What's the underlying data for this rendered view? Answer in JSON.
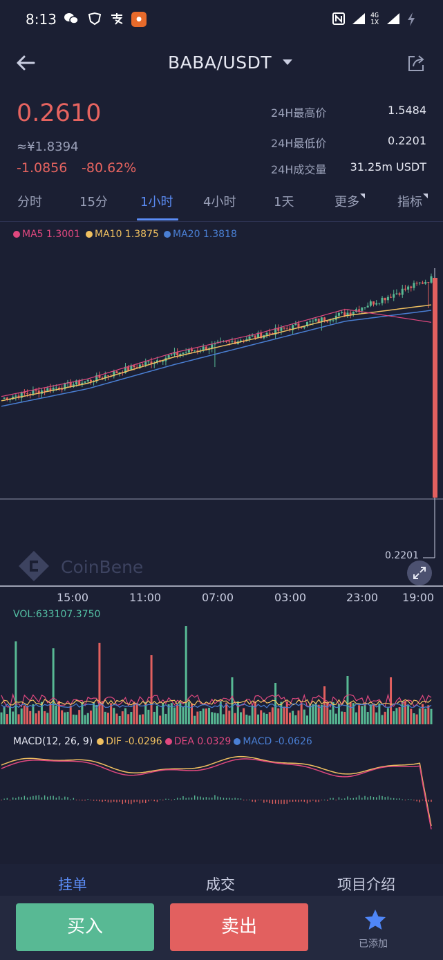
{
  "status_bar": {
    "time": "8:13",
    "network": "4G",
    "sim": "1X"
  },
  "header": {
    "pair": "BABA/USDT"
  },
  "price": {
    "last": "0.2610",
    "cny": "≈¥1.8394",
    "change_abs": "-1.0856",
    "change_pct": "-80.62%"
  },
  "stats": [
    {
      "label": "24H最高价",
      "value": "1.5484"
    },
    {
      "label": "24H最低价",
      "value": "0.2201"
    },
    {
      "label": "24H成交量",
      "value": "31.25m USDT"
    }
  ],
  "interval_tabs": [
    "分时",
    "15分",
    "1小时",
    "4小时",
    "1天",
    "更多",
    "指标"
  ],
  "active_tab": "1小时",
  "ma_legend": {
    "ma5": "MA5 1.3001",
    "ma10": "MA10 1.3875",
    "ma20": "MA20 1.3818"
  },
  "colors": {
    "up": "#58b994",
    "down": "#e2605f",
    "ma5": "#e0487f",
    "ma10": "#f0c060",
    "ma20": "#4a7fd4",
    "accent": "#5b8cf5"
  },
  "watermark": "CoinBene",
  "low_marker": "0.2201",
  "x_ticks": [
    "15:00",
    "11:00",
    "07:00",
    "03:00",
    "23:00",
    "19:00"
  ],
  "volume_label": "VOL:633107.3750",
  "macd_legend": {
    "title": "MACD(12, 26, 9)",
    "dif": "DIF -0.0296",
    "dea": "DEA 0.0329",
    "macd": "MACD -0.0626"
  },
  "bottom_tabs": [
    "挂单",
    "成交",
    "项目介绍"
  ],
  "actions": {
    "buy": "买入",
    "sell": "卖出",
    "favorite": "已添加"
  },
  "chart_data": {
    "type": "line",
    "x": [
      "15:00",
      "11:00",
      "07:00",
      "03:00",
      "23:00",
      "19:00"
    ],
    "series": [
      {
        "name": "MA5 1.3001",
        "values": [
          0.96,
          1.04,
          1.16,
          1.25,
          1.36,
          1.3
        ]
      },
      {
        "name": "MA10 1.3875",
        "values": [
          0.95,
          1.03,
          1.15,
          1.24,
          1.34,
          1.39
        ]
      },
      {
        "name": "MA20 1.3818",
        "values": [
          0.94,
          1.02,
          1.13,
          1.23,
          1.33,
          1.38
        ]
      }
    ],
    "high": 1.5484,
    "low": 0.2201,
    "last": 0.261
  }
}
